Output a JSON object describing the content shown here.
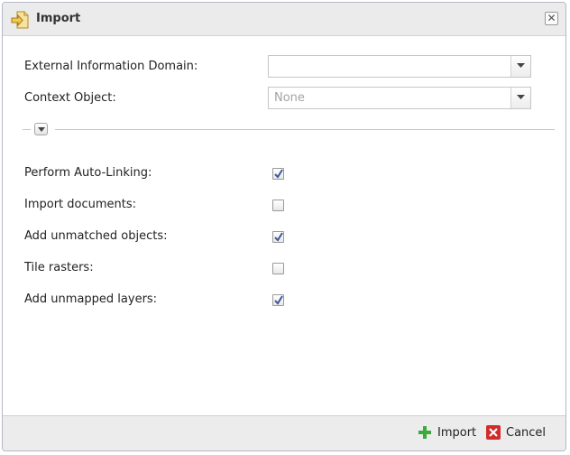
{
  "dialog": {
    "title": "Import",
    "close_icon": "close-icon"
  },
  "fields": {
    "domain_label": "External Information Domain:",
    "domain_value": "",
    "context_label": "Context Object:",
    "context_value": "None"
  },
  "options": [
    {
      "label": "Perform Auto-Linking:",
      "checked": true
    },
    {
      "label": "Import documents:",
      "checked": false
    },
    {
      "label": "Add unmatched objects:",
      "checked": true
    },
    {
      "label": "Tile rasters:",
      "checked": false
    },
    {
      "label": "Add unmapped layers:",
      "checked": true
    }
  ],
  "footer": {
    "import_label": "Import",
    "cancel_label": "Cancel"
  },
  "colors": {
    "accent_green": "#3cab3c",
    "cancel_red": "#d22b2b",
    "check_blue": "#3b5998"
  }
}
